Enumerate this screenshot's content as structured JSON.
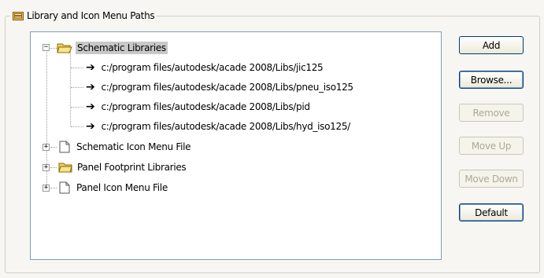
{
  "group": {
    "title": "Library and Icon Menu Paths"
  },
  "tree": {
    "root": {
      "label": "Schematic Libraries",
      "children": [
        "c:/program files/autodesk/acade 2008/Libs/jic125",
        "c:/program files/autodesk/acade 2008/Libs/pneu_iso125",
        "c:/program files/autodesk/acade 2008/Libs/pid",
        "c:/program files/autodesk/acade 2008/Libs/hyd_iso125/"
      ]
    },
    "others": [
      {
        "label": "Schematic Icon Menu File",
        "icon": "file-icon"
      },
      {
        "label": "Panel Footprint Libraries",
        "icon": "folder-icon"
      },
      {
        "label": "Panel Icon Menu File",
        "icon": "file-icon"
      }
    ]
  },
  "buttons": {
    "add": "Add",
    "browse": "Browse...",
    "remove": "Remove",
    "move_up": "Move Up",
    "move_down": "Move Down",
    "default": "Default"
  }
}
